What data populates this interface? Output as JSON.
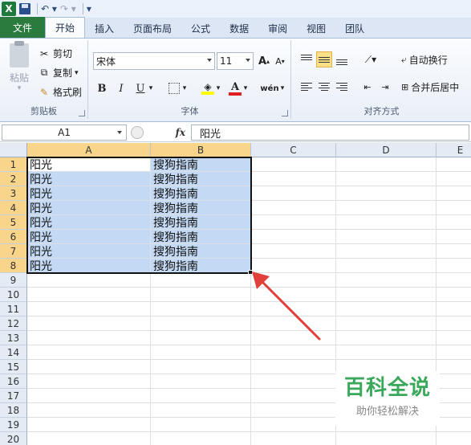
{
  "quick_access": {
    "app_icon": "excel-icon",
    "save_icon": "save-icon",
    "undo_icon": "undo-icon",
    "redo_icon": "redo-icon",
    "customize_icon": "customize-qat-icon"
  },
  "tabs": [
    {
      "label": "文件"
    },
    {
      "label": "开始"
    },
    {
      "label": "插入"
    },
    {
      "label": "页面布局"
    },
    {
      "label": "公式"
    },
    {
      "label": "数据"
    },
    {
      "label": "审阅"
    },
    {
      "label": "视图"
    },
    {
      "label": "团队"
    }
  ],
  "ribbon": {
    "clipboard": {
      "paste_label": "粘贴",
      "cut_label": "剪切",
      "copy_label": "复制",
      "format_painter_label": "格式刷",
      "group_label": "剪贴板"
    },
    "font": {
      "font_name": "宋体",
      "font_size": "11",
      "grow_label": "A",
      "shrink_label": "A",
      "bold_label": "B",
      "italic_label": "I",
      "underline_label": "U",
      "font_color_label": "A",
      "phonetic_label": "wén",
      "group_label": "字体",
      "fill_color": "#ffff00",
      "font_color": "#e02020"
    },
    "alignment": {
      "wrap_text_label": "自动换行",
      "merge_label": "合并后居中",
      "group_label": "对齐方式"
    }
  },
  "formula_bar": {
    "name_box": "A1",
    "fx_label": "fx",
    "content": "阳光"
  },
  "sheet": {
    "columns": [
      "A",
      "B",
      "C",
      "D",
      "E"
    ],
    "rows": [
      "1",
      "2",
      "3",
      "4",
      "5",
      "6",
      "7",
      "8",
      "9",
      "10",
      "11",
      "12",
      "13",
      "14",
      "15",
      "16",
      "17",
      "18",
      "19",
      "20"
    ],
    "data": [
      [
        "阳光",
        "搜狗指南"
      ],
      [
        "阳光",
        "搜狗指南"
      ],
      [
        "阳光",
        "搜狗指南"
      ],
      [
        "阳光",
        "搜狗指南"
      ],
      [
        "阳光",
        "搜狗指南"
      ],
      [
        "阳光",
        "搜狗指南"
      ],
      [
        "阳光",
        "搜狗指南"
      ],
      [
        "阳光",
        "搜狗指南"
      ]
    ],
    "selection_color": "#c3d9f4",
    "header_highlight": "#f8d58a"
  },
  "annotation": {
    "arrow_color": "#e0413a"
  },
  "watermark": {
    "main": "百科全说",
    "sub": "助你轻松解决",
    "color": "#3aa85a"
  }
}
